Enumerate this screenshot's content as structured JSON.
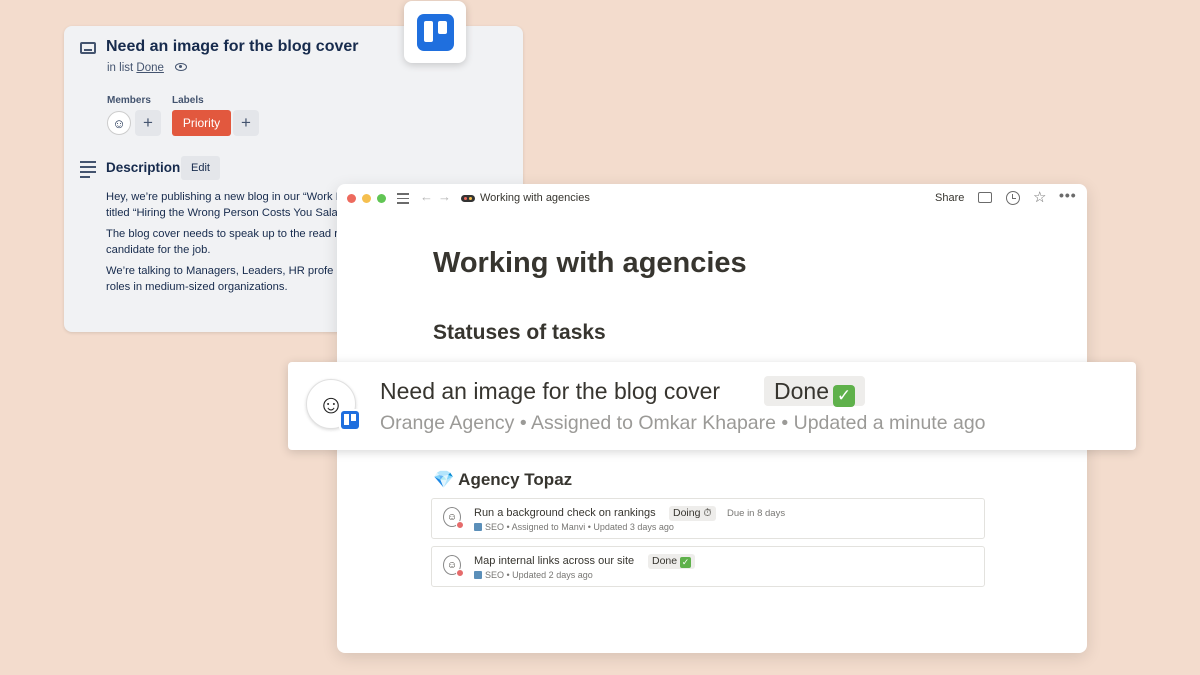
{
  "trello_card": {
    "title": "Need an image for the blog cover",
    "in_list_prefix": "in list",
    "list_name": "Done",
    "members_label": "Members",
    "labels_label": "Labels",
    "label_priority": "Priority",
    "add_icon": "plus",
    "description_heading": "Description",
    "edit_label": "Edit",
    "description_paragraphs": [
      "Hey, we’re publishing a new blog in our “Work It’s titled “Hiring the Wrong Person Costs You Salary.”",
      "The blog cover needs to speak up to the read right candidate for the job.",
      "We’re talking to Managers, Leaders, HR profe roles in medium-sized organizations."
    ],
    "label_color": "#e2583e"
  },
  "notion_window": {
    "breadcrumb": "Working with agencies",
    "share_label": "Share",
    "page_title": "Working with agencies",
    "section_heading": "Statuses of tasks",
    "agency_heading": "Agency Topaz",
    "agency_icon": "💎",
    "tasks": [
      {
        "name": "Run a background check on rankings",
        "status": "Doing ⏱",
        "due": "Due in 8 days",
        "meta": "SEO • Assigned to Manvi • Updated 3 days ago"
      },
      {
        "name": "Map internal links across our site",
        "status": "Done",
        "status_check": "✓",
        "meta": "SEO • Updated 2 days ago"
      }
    ]
  },
  "highlight": {
    "title": "Need an image for the blog cover",
    "status": "Done",
    "status_check": "✓",
    "meta": "Orange Agency • Assigned to Omkar Khapare • Updated a minute ago"
  },
  "colors": {
    "background": "#f3dccd",
    "trello_blue": "#1f6fde",
    "done_green": "#5fb14b"
  }
}
